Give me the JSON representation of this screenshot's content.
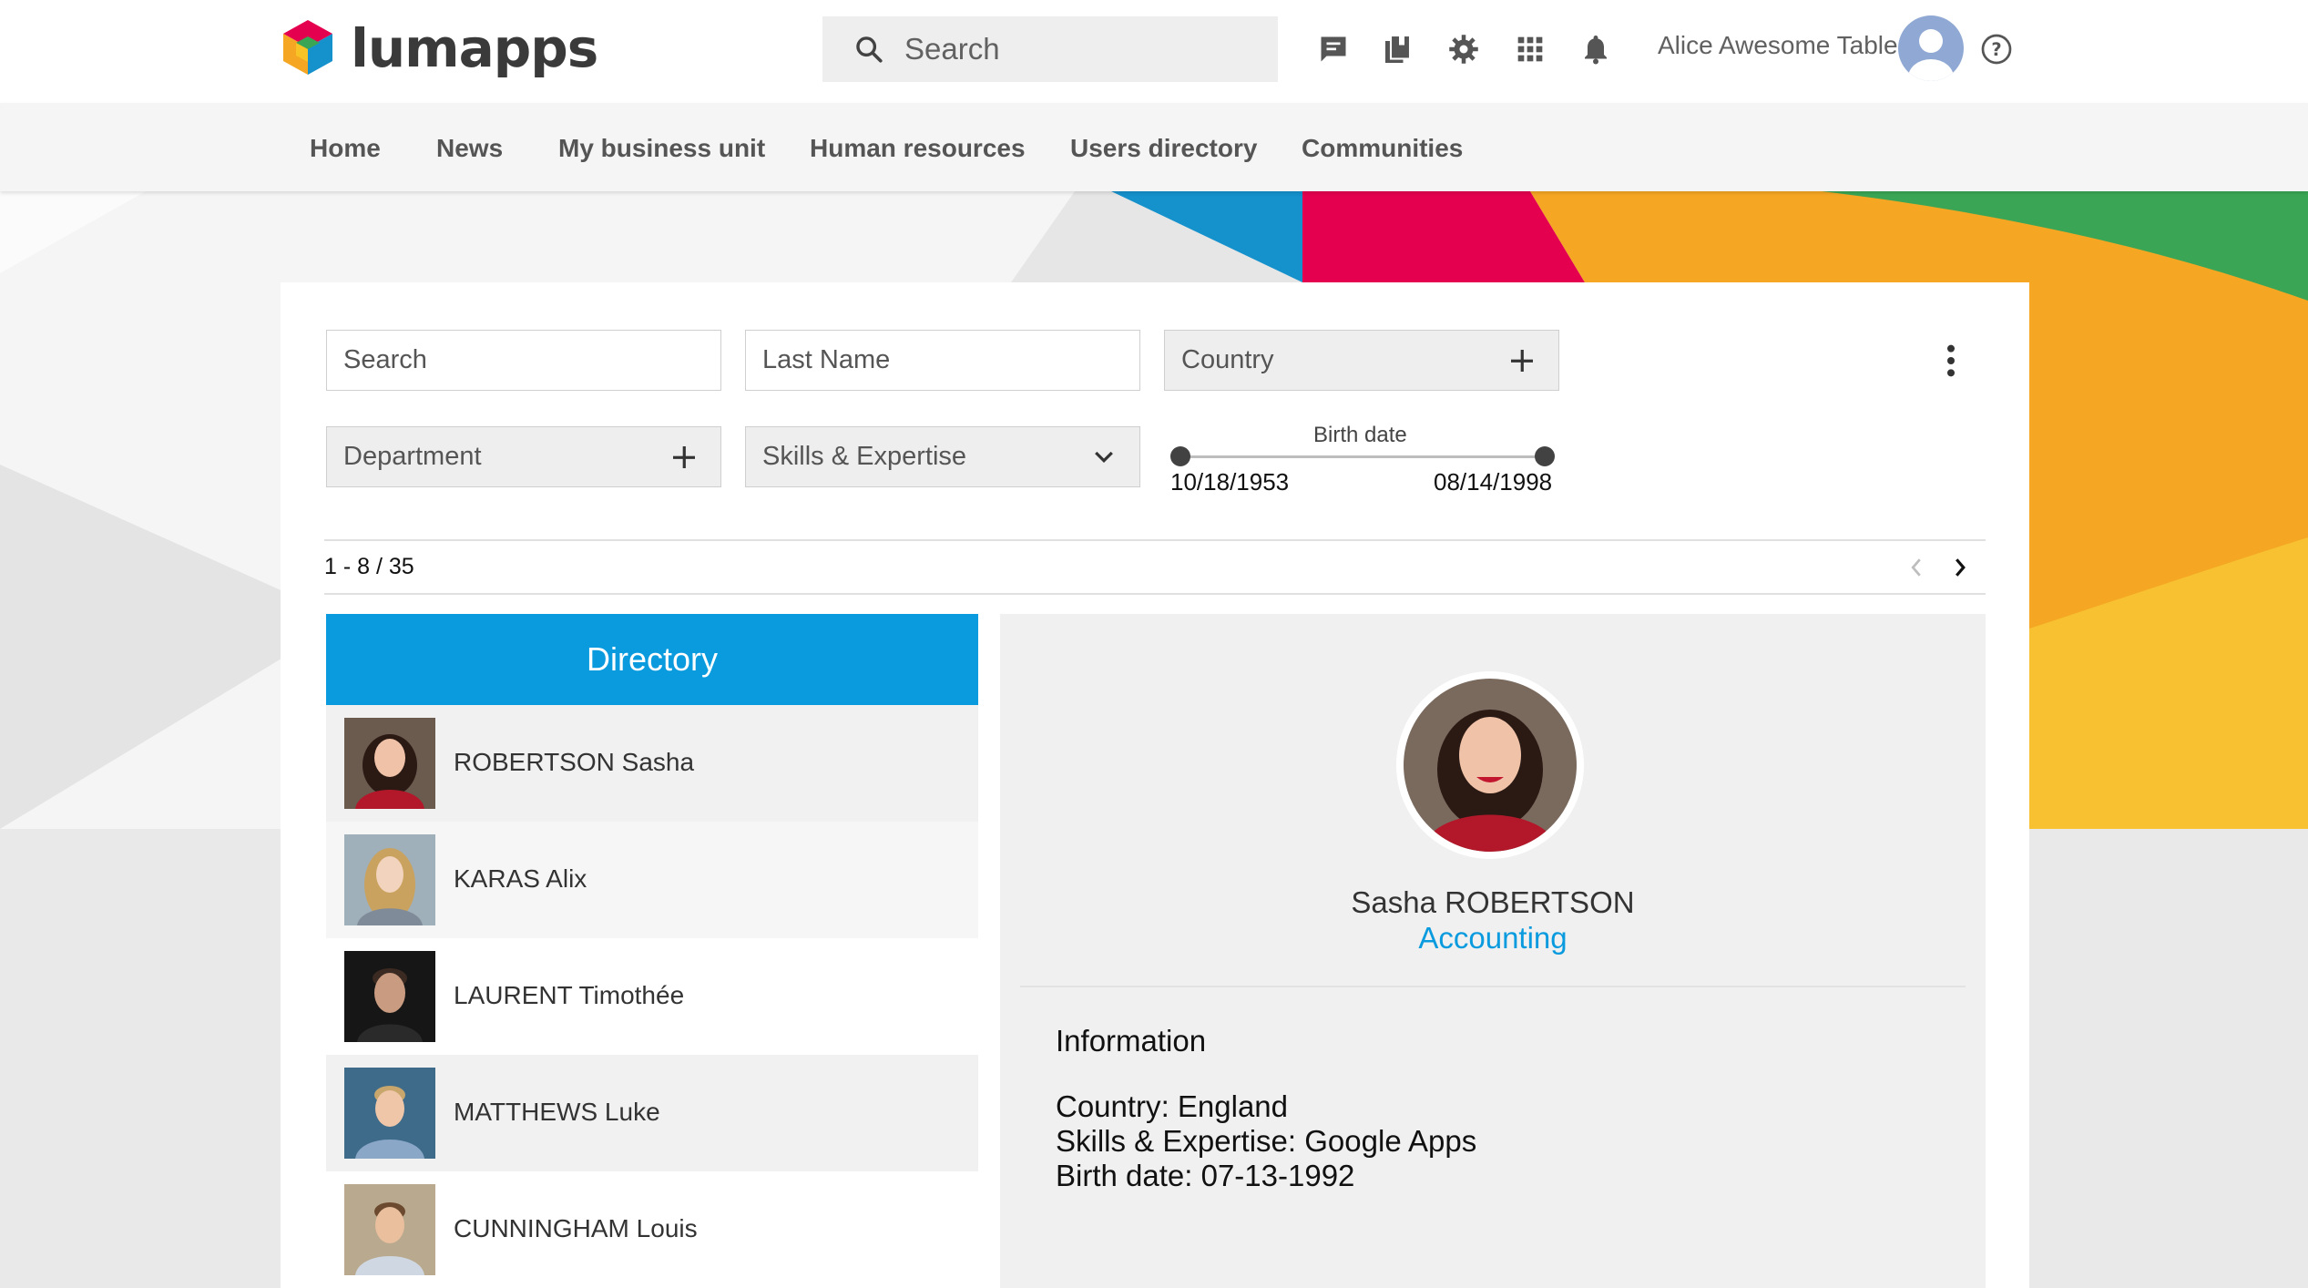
{
  "brand": {
    "name": "lumapps"
  },
  "search": {
    "placeholder": "Search"
  },
  "header_icons": [
    "chat-icon",
    "library-icon",
    "settings-icon",
    "apps-grid-icon",
    "notifications-icon"
  ],
  "user": {
    "name": "Alice Awesome Table"
  },
  "nav": {
    "items": [
      {
        "label": "Home"
      },
      {
        "label": "News"
      },
      {
        "label": "My business unit"
      },
      {
        "label": "Human resources"
      },
      {
        "label": "Users directory"
      },
      {
        "label": "Communities"
      }
    ]
  },
  "filters": {
    "search_placeholder": "Search",
    "last_name_placeholder": "Last Name",
    "country_label": "Country",
    "department_label": "Department",
    "skills_label": "Skills & Expertise",
    "birth_date": {
      "label": "Birth date",
      "min": "10/18/1953",
      "max": "08/14/1998"
    }
  },
  "pagination": {
    "text": "1 - 8 / 35"
  },
  "directory": {
    "title": "Directory",
    "people": [
      {
        "last": "ROBERTSON",
        "first": "Sasha",
        "selected": true
      },
      {
        "last": "KARAS",
        "first": "Alix"
      },
      {
        "last": "LAURENT",
        "first": "Timothée"
      },
      {
        "last": "MATTHEWS",
        "first": "Luke"
      },
      {
        "last": "CUNNINGHAM",
        "first": "Louis"
      }
    ]
  },
  "profile": {
    "name": "Sasha ROBERTSON",
    "department": "Accounting",
    "info_title": "Information",
    "fields": [
      {
        "label": "Country",
        "value": "England"
      },
      {
        "label": "Skills & Expertise",
        "value": "Google Apps"
      },
      {
        "label": "Birth date",
        "value": "07-13-1992"
      }
    ]
  },
  "colors": {
    "accent": "#0a9bdf",
    "banner_pink": "#e4004f",
    "banner_orange": "#f5a623",
    "banner_blue": "#1591cc",
    "banner_green": "#3aa655"
  }
}
